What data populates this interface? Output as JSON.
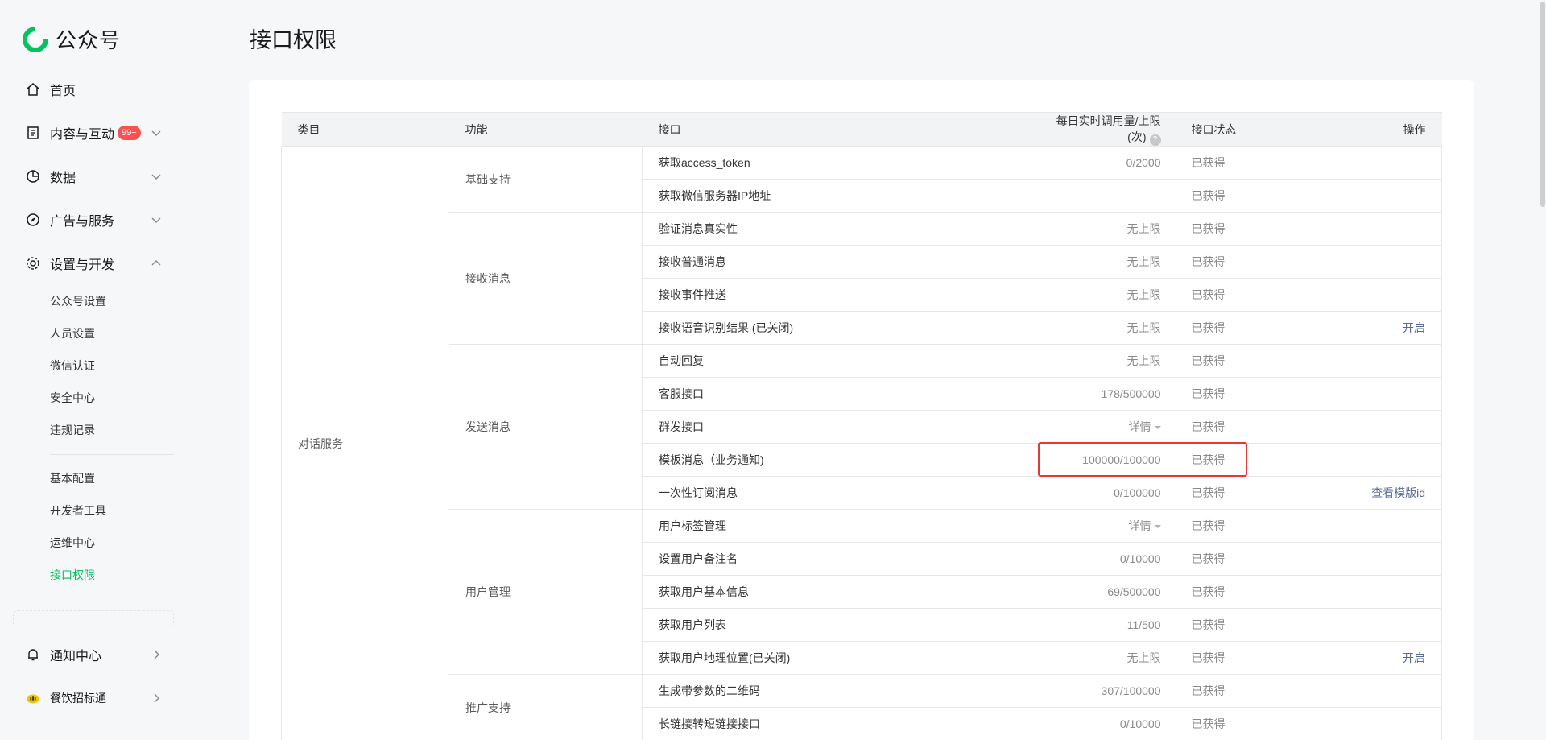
{
  "app": {
    "name": "公众号",
    "brand_color": "#07c160"
  },
  "sidebar": {
    "items": [
      {
        "label": "首页",
        "icon": "home-icon"
      },
      {
        "label": "内容与互动",
        "icon": "document-icon",
        "badge": "99+"
      },
      {
        "label": "数据",
        "icon": "pie-chart-icon"
      },
      {
        "label": "广告与服务",
        "icon": "compass-icon"
      },
      {
        "label": "设置与开发",
        "icon": "gear-icon"
      }
    ],
    "settings_sub": [
      "公众号设置",
      "人员设置",
      "微信认证",
      "安全中心",
      "违规记录"
    ],
    "dev_sub": [
      "基本配置",
      "开发者工具",
      "运维中心",
      "接口权限"
    ],
    "bottom": [
      {
        "label": "通知中心",
        "icon": "bell-icon"
      },
      {
        "label": "餐饮招标通",
        "icon": "app-logo-icon"
      }
    ]
  },
  "page": {
    "title": "接口权限"
  },
  "table": {
    "headers": {
      "category": "类目",
      "function": "功能",
      "api": "接口",
      "usage": "每日实时调用量/上限(次)",
      "status": "接口状态",
      "op": "操作"
    },
    "category": "对话服务",
    "groups": [
      {
        "function": "基础支持",
        "rows": [
          {
            "api": "获取access_token",
            "usage": "0/2000",
            "status": "已获得",
            "op": ""
          },
          {
            "api": "获取微信服务器IP地址",
            "usage": "",
            "status": "已获得",
            "op": ""
          }
        ]
      },
      {
        "function": "接收消息",
        "rows": [
          {
            "api": "验证消息真实性",
            "usage": "无上限",
            "status": "已获得",
            "op": ""
          },
          {
            "api": "接收普通消息",
            "usage": "无上限",
            "status": "已获得",
            "op": ""
          },
          {
            "api": "接收事件推送",
            "usage": "无上限",
            "status": "已获得",
            "op": ""
          },
          {
            "api": "接收语音识别结果 (已关闭)",
            "usage": "无上限",
            "status": "已获得",
            "op": "开启"
          }
        ]
      },
      {
        "function": "发送消息",
        "rows": [
          {
            "api": "自动回复",
            "usage": "无上限",
            "status": "已获得",
            "op": ""
          },
          {
            "api": "客服接口",
            "usage": "178/500000",
            "status": "已获得",
            "op": ""
          },
          {
            "api": "群发接口",
            "usage": "详情",
            "status": "已获得",
            "op": ""
          },
          {
            "api": "模板消息（业务通知)",
            "usage": "100000/100000",
            "status": "已获得",
            "op": ""
          },
          {
            "api": "一次性订阅消息",
            "usage": "0/100000",
            "status": "已获得",
            "op": "查看模版id"
          }
        ]
      },
      {
        "function": "用户管理",
        "rows": [
          {
            "api": "用户标签管理",
            "usage": "详情",
            "status": "已获得",
            "op": ""
          },
          {
            "api": "设置用户备注名",
            "usage": "0/10000",
            "status": "已获得",
            "op": ""
          },
          {
            "api": "获取用户基本信息",
            "usage": "69/500000",
            "status": "已获得",
            "op": ""
          },
          {
            "api": "获取用户列表",
            "usage": "11/500",
            "status": "已获得",
            "op": ""
          },
          {
            "api": "获取用户地理位置(已关闭)",
            "usage": "无上限",
            "status": "已获得",
            "op": "开启"
          }
        ]
      },
      {
        "function": "推广支持",
        "rows": [
          {
            "api": "生成带参数的二维码",
            "usage": "307/100000",
            "status": "已获得",
            "op": ""
          },
          {
            "api": "长链接转短链接接口",
            "usage": "0/10000",
            "status": "已获得",
            "op": ""
          }
        ]
      }
    ]
  }
}
